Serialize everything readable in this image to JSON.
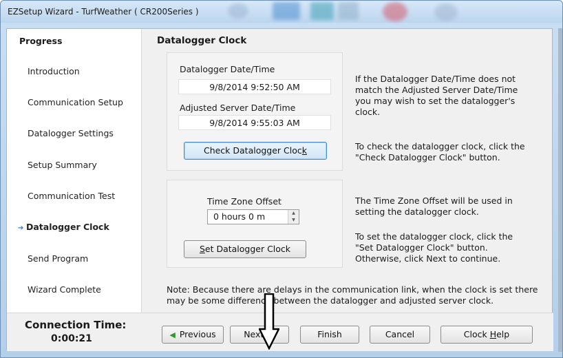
{
  "window": {
    "title": "EZSetup Wizard - TurfWeather ( CR200Series )"
  },
  "sidebar": {
    "title": "Progress",
    "items": [
      {
        "label": "Introduction"
      },
      {
        "label": "Communication Setup"
      },
      {
        "label": "Datalogger Settings"
      },
      {
        "label": "Setup Summary"
      },
      {
        "label": "Communication Test"
      },
      {
        "label": "Datalogger Clock",
        "active": true
      },
      {
        "label": "Send Program"
      },
      {
        "label": "Wizard Complete"
      }
    ]
  },
  "main": {
    "title": "Datalogger Clock",
    "datalogger_label": "Datalogger Date/Time",
    "datalogger_value": "9/8/2014 9:52:50 AM",
    "server_label": "Adjusted Server Date/Time",
    "server_value": "9/8/2014 9:55:03 AM",
    "check_button": {
      "pre": "Check Datalogger Cloc",
      "accel": "k"
    },
    "tz_label": "Time Zone Offset",
    "tz_value": "0 hours 0 m",
    "set_button": {
      "accel": "S",
      "post": "et Datalogger Clock"
    },
    "desc1": "If the Datalogger Date/Time does not match the Adjusted Server Date/Time you may wish to set the datalogger's clock.",
    "desc2": "To check the datalogger clock, click the \"Check Datalogger Clock\" button.",
    "desc3": "The Time Zone Offset will be used in setting the datalogger clock.",
    "desc4": "To set the datalogger clock, click the \"Set Datalogger Clock\" button. Otherwise, click Next to continue.",
    "note": "Note: Because there are delays in the communication link, when the clock is set there may be some difference between the datalogger and adjusted server clock."
  },
  "footer": {
    "connection_label": "Connection Time:",
    "connection_value": "0:00:21",
    "buttons": {
      "previous": "Previous",
      "next": "Next",
      "finish": "Finish",
      "cancel": "Cancel",
      "help_pre": "Clock ",
      "help_accel": "H",
      "help_post": "elp"
    }
  },
  "icons": {
    "active_step": "arrow-right-icon",
    "previous": "triangle-left-icon",
    "next": "triangle-right-icon",
    "annotation": "down-arrow-annotation"
  },
  "colors": {
    "active_arrow": "#3a78c6",
    "nav_triangle": "#2f9a2f",
    "primary_border": "#3c8ed8"
  }
}
